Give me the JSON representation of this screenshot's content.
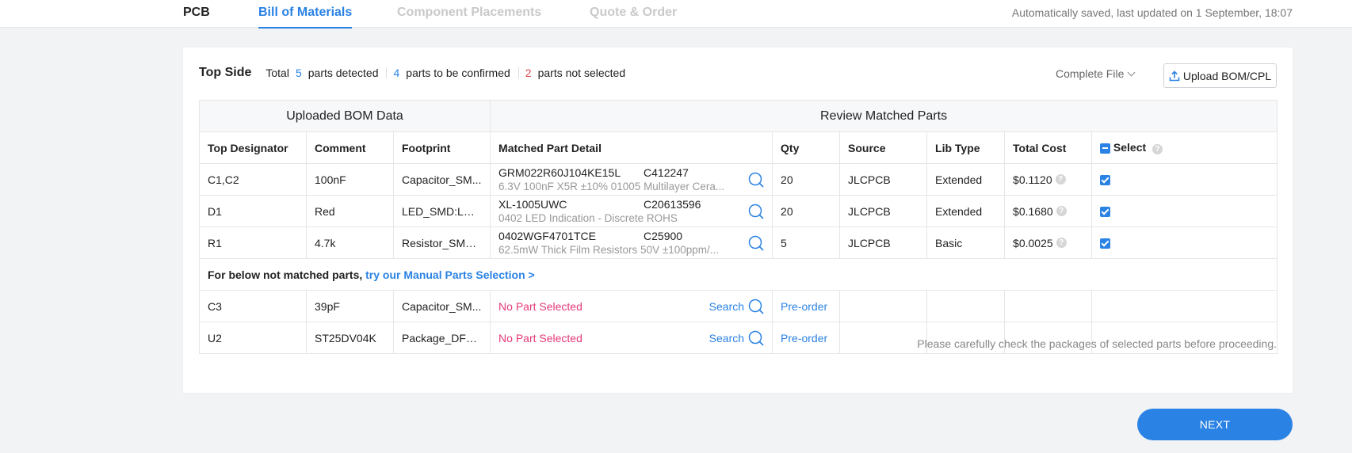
{
  "tabs": {
    "pcb": "PCB",
    "bom": "Bill of Materials",
    "placements": "Component Placements",
    "quote": "Quote & Order"
  },
  "saved_status": "Automatically saved, last updated on 1 September, 18:07",
  "summary": {
    "title": "Top Side",
    "total_label": "Total",
    "total": "5",
    "detected_label": "parts detected",
    "confirm_count": "4",
    "confirm_label": "parts to be confirmed",
    "not_selected_count": "2",
    "not_selected_label": "parts not selected"
  },
  "file_select": "Complete File",
  "upload_label": "Upload BOM/CPL",
  "table": {
    "group_uploaded": "Uploaded BOM Data",
    "group_review": "Review Matched Parts",
    "headers": {
      "designator": "Top Designator",
      "comment": "Comment",
      "footprint": "Footprint",
      "matched": "Matched Part Detail",
      "qty": "Qty",
      "source": "Source",
      "lib_type": "Lib Type",
      "total_cost": "Total Cost",
      "select": "Select"
    },
    "matched_rows": [
      {
        "designator": "C1,C2",
        "comment": "100nF",
        "footprint": "Capacitor_SM...",
        "part_number": "GRM022R60J104KE15L",
        "lcsc": "C412247",
        "description": "6.3V 100nF X5R ±10% 01005 Multilayer Cera...",
        "qty": "20",
        "source": "JLCPCB",
        "lib_type": "Extended",
        "total_cost": "$0.1120"
      },
      {
        "designator": "D1",
        "comment": "Red",
        "footprint": "LED_SMD:LED...",
        "part_number": "XL-1005UWC",
        "lcsc": "C20613596",
        "description": "0402 LED Indication - Discrete ROHS",
        "qty": "20",
        "source": "JLCPCB",
        "lib_type": "Extended",
        "total_cost": "$0.1680"
      },
      {
        "designator": "R1",
        "comment": "4.7k",
        "footprint": "Resistor_SMD:...",
        "part_number": "0402WGF4701TCE",
        "lcsc": "C25900",
        "description": "62.5mW Thick Film Resistors 50V ±100ppm/...",
        "qty": "5",
        "source": "JLCPCB",
        "lib_type": "Basic",
        "total_cost": "$0.0025"
      }
    ],
    "manual_prefix": "For below not matched parts,",
    "manual_link": "try our Manual Parts Selection >",
    "unmatched_rows": [
      {
        "designator": "C3",
        "comment": "39pF",
        "footprint": "Capacitor_SM...",
        "status": "No Part Selected",
        "search": "Search",
        "preorder": "Pre-order"
      },
      {
        "designator": "U2",
        "comment": "ST25DV04K",
        "footprint": "Package_DFN...",
        "status": "No Part Selected",
        "search": "Search",
        "preorder": "Pre-order"
      }
    ]
  },
  "note": "Please carefully check the packages of selected parts before proceeding.",
  "next_label": "NEXT",
  "colors": {
    "accent": "#2a82e4",
    "error": "#e5484d",
    "no_part": "#e5397a"
  }
}
